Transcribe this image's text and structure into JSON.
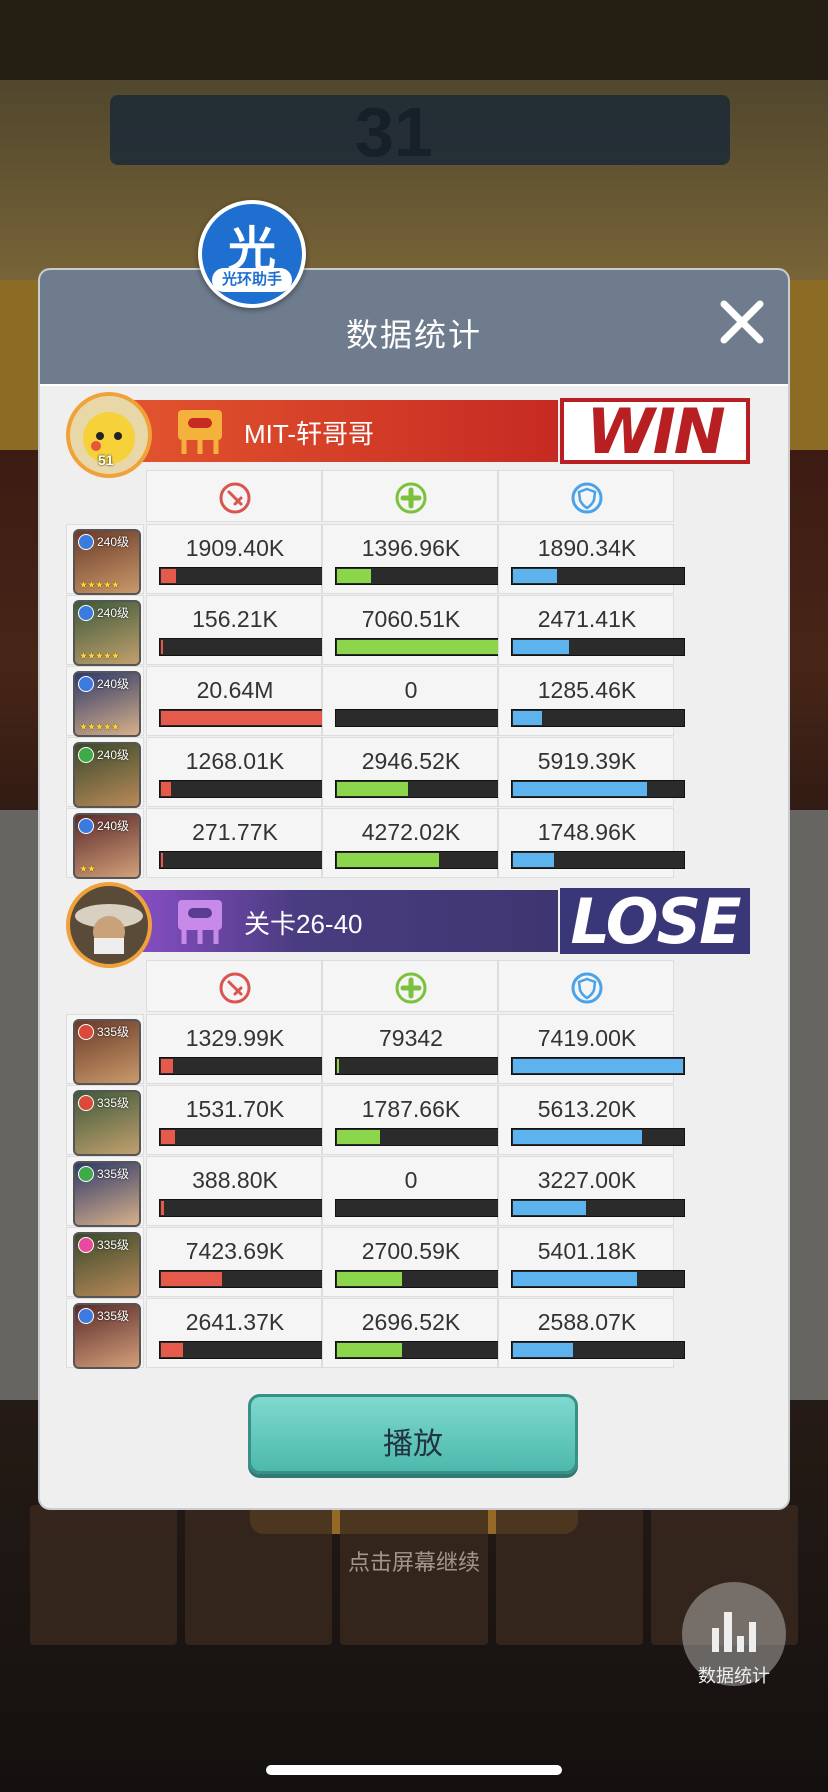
{
  "background": {
    "tap_to_continue": "点击屏幕继续",
    "stats_button_label": "数据统计"
  },
  "helper_badge": {
    "glyph": "光",
    "name": "光环助手"
  },
  "dialog": {
    "title": "数据统计",
    "close_icon": "close-icon",
    "play_button": "播放"
  },
  "stat_icons": {
    "damage": "sword-icon",
    "heal": "plus-icon",
    "tank": "shield-icon"
  },
  "colors": {
    "win": "#c62a22",
    "lose": "#3a3778",
    "damage": "#e55a4a",
    "heal": "#8bd64a",
    "tank": "#5cb3ee"
  },
  "teams": [
    {
      "name": "MIT-轩哥哥",
      "result": "WIN",
      "player_level": "51",
      "heroes": [
        {
          "level": "240级",
          "stars": 5,
          "damage": "1909.40K",
          "damage_pct": 9,
          "heal": "1396.96K",
          "heal_pct": 20,
          "tank": "1890.34K",
          "tank_pct": 26
        },
        {
          "level": "240级",
          "stars": 5,
          "damage": "156.21K",
          "damage_pct": 1,
          "heal": "7060.51K",
          "heal_pct": 100,
          "tank": "2471.41K",
          "tank_pct": 33
        },
        {
          "level": "240级",
          "stars": 5,
          "damage": "20.64M",
          "damage_pct": 100,
          "heal": "0",
          "heal_pct": 0,
          "tank": "1285.46K",
          "tank_pct": 17
        },
        {
          "level": "240级",
          "stars": 0,
          "damage": "1268.01K",
          "damage_pct": 6,
          "heal": "2946.52K",
          "heal_pct": 42,
          "tank": "5919.39K",
          "tank_pct": 79
        },
        {
          "level": "240级",
          "stars": 2,
          "damage": "271.77K",
          "damage_pct": 1,
          "heal": "4272.02K",
          "heal_pct": 60,
          "tank": "1748.96K",
          "tank_pct": 24
        }
      ]
    },
    {
      "name": "关卡26-40",
      "result": "LOSE",
      "heroes": [
        {
          "level": "335级",
          "stars": 0,
          "damage": "1329.99K",
          "damage_pct": 7,
          "heal": "79342",
          "heal_pct": 1,
          "tank": "7419.00K",
          "tank_pct": 100
        },
        {
          "level": "335级",
          "stars": 0,
          "damage": "1531.70K",
          "damage_pct": 8,
          "heal": "1787.66K",
          "heal_pct": 25,
          "tank": "5613.20K",
          "tank_pct": 76
        },
        {
          "level": "335级",
          "stars": 0,
          "damage": "388.80K",
          "damage_pct": 2,
          "heal": "0",
          "heal_pct": 0,
          "tank": "3227.00K",
          "tank_pct": 43
        },
        {
          "level": "335级",
          "stars": 0,
          "damage": "7423.69K",
          "damage_pct": 36,
          "heal": "2700.59K",
          "heal_pct": 38,
          "tank": "5401.18K",
          "tank_pct": 73
        },
        {
          "level": "335级",
          "stars": 0,
          "damage": "2641.37K",
          "damage_pct": 13,
          "heal": "2696.52K",
          "heal_pct": 38,
          "tank": "2588.07K",
          "tank_pct": 35
        }
      ]
    }
  ]
}
